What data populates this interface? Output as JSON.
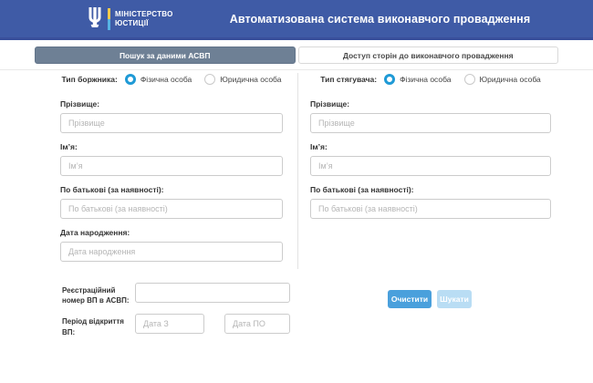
{
  "header": {
    "ministry_line1": "МІНІСТЕРСТВО",
    "ministry_line2": "ЮСТИЦІЇ",
    "title": "Автоматизована система виконавчого провадження"
  },
  "tabs": [
    {
      "label": "Пошук за даними АСВП",
      "active": true
    },
    {
      "label": "Доступ сторін до виконавчого провадження",
      "active": false
    }
  ],
  "debtor": {
    "type_label": "Тип боржника:",
    "radio_individual": "Фізична особа",
    "radio_legal": "Юридична особа",
    "selected_type": "Фізична особа",
    "fields": [
      {
        "label": "Прізвище:",
        "placeholder": "Прізвище",
        "value": ""
      },
      {
        "label": "Ім’я:",
        "placeholder": "Ім’я",
        "value": ""
      },
      {
        "label": "По батькові (за наявності):",
        "placeholder": "По батькові (за наявності)",
        "value": ""
      },
      {
        "label": "Дата народження:",
        "placeholder": "Дата народження",
        "value": ""
      }
    ]
  },
  "claimant": {
    "type_label": "Тип стягувача:",
    "radio_individual": "Фізична особа",
    "radio_legal": "Юридична особа",
    "selected_type": "Фізична особа",
    "fields": [
      {
        "label": "Прізвище:",
        "placeholder": "Прізвище",
        "value": ""
      },
      {
        "label": "Ім’я:",
        "placeholder": "Ім’я",
        "value": ""
      },
      {
        "label": "По батькові (за наявності):",
        "placeholder": "По батькові (за наявності)",
        "value": ""
      }
    ]
  },
  "bottom": {
    "reg_number_label": "Реєстраційний номер ВП в АСВП:",
    "reg_number_value": "",
    "period_label": "Період відкриття ВП:",
    "date_from_placeholder": "Дата З",
    "date_to_placeholder": "Дата ПО",
    "clear_button": "Очистити",
    "search_button": "Шукати"
  },
  "colors": {
    "header_blue": "#3f5ba6",
    "active_tab": "#6e8095",
    "radio_blue": "#1f9ad6",
    "clear_button_blue": "#4aa0dc",
    "search_button_disabled": "#b9ddf4",
    "flag_yellow": "#f2c94c",
    "flag_blue": "#56b3e4"
  }
}
